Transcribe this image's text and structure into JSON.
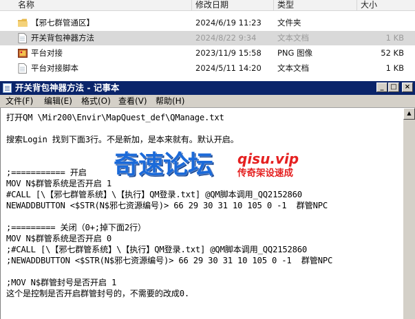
{
  "explorer": {
    "columns": {
      "name": "名称",
      "modified": "修改日期",
      "type": "类型",
      "size": "大小"
    },
    "files": [
      {
        "name": "【邪七群管通区】",
        "modified": "2024/6/19 11:23",
        "type": "文件夹",
        "size": "",
        "icon": "folder-icon"
      },
      {
        "name": "开关背包神器方法",
        "modified": "2024/8/22 9:34",
        "type": "文本文档",
        "size": "1 KB",
        "icon": "text-file-icon"
      },
      {
        "name": "平台对接",
        "modified": "2023/11/9 15:58",
        "type": "PNG 图像",
        "size": "52 KB",
        "icon": "image-file-icon"
      },
      {
        "name": "平台对接脚本",
        "modified": "2024/5/11 14:20",
        "type": "文本文档",
        "size": "1 KB",
        "icon": "text-file-icon"
      }
    ]
  },
  "notepad": {
    "title": "开关背包神器方法 - 记事本",
    "window_buttons": {
      "minimize": "_",
      "maximize": "□",
      "close": "×"
    },
    "menu": [
      "文件(F)",
      "编辑(E)",
      "格式(O)",
      "查看(V)",
      "帮助(H)"
    ],
    "lines": [
      "打开QM \\Mir200\\Envir\\MapQuest_def\\QManage.txt",
      "",
      "搜索Login 找到下面3行。不是新加，是本来就有。默认开启。",
      "",
      "",
      ";=========== 开启",
      "MOV N$群管系统是否开启 1",
      "#CALL [\\【邪七群管系统】\\【执行】QM登录.txt] @QM脚本调用_QQ2152860",
      "NEWADDBUTTON <$STR(N$邪七资源编号)> 66 29 30 31 10 105 0 -1  群管NPC",
      "",
      ";========= 关闭（0+;掉下面2行）",
      "MOV N$群管系统是否开启 0",
      ";#CALL [\\【邪七群管系统】\\【执行】QM登录.txt] @QM脚本调用_QQ2152860",
      ";NEWADDBUTTON <$STR(N$邪七资源编号)> 66 29 30 31 10 105 0 -1  群管NPC",
      "",
      ";MOV N$群管封号是否开启 1",
      "这个是控制是否开启群管封号的，不需要的改成0."
    ]
  },
  "watermark": {
    "main": "奇速论坛",
    "site": "qisu.vip",
    "slogan": "传奇架设速成"
  }
}
